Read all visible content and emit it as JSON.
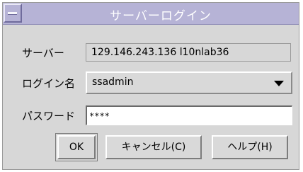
{
  "window": {
    "title": "サーバーログイン"
  },
  "form": {
    "server_label": "サーバー",
    "server_value": "129.146.243.136 l10nlab36",
    "login_label": "ログイン名",
    "login_value": "ssadmin",
    "password_label": "パスワード",
    "password_value": "****"
  },
  "buttons": {
    "ok": "OK",
    "cancel": "キャンセル(C)",
    "help": "ヘルプ(H)"
  },
  "colors": {
    "titlebar": "#b6b3d6",
    "dialog_background": "#d7d7d7"
  }
}
